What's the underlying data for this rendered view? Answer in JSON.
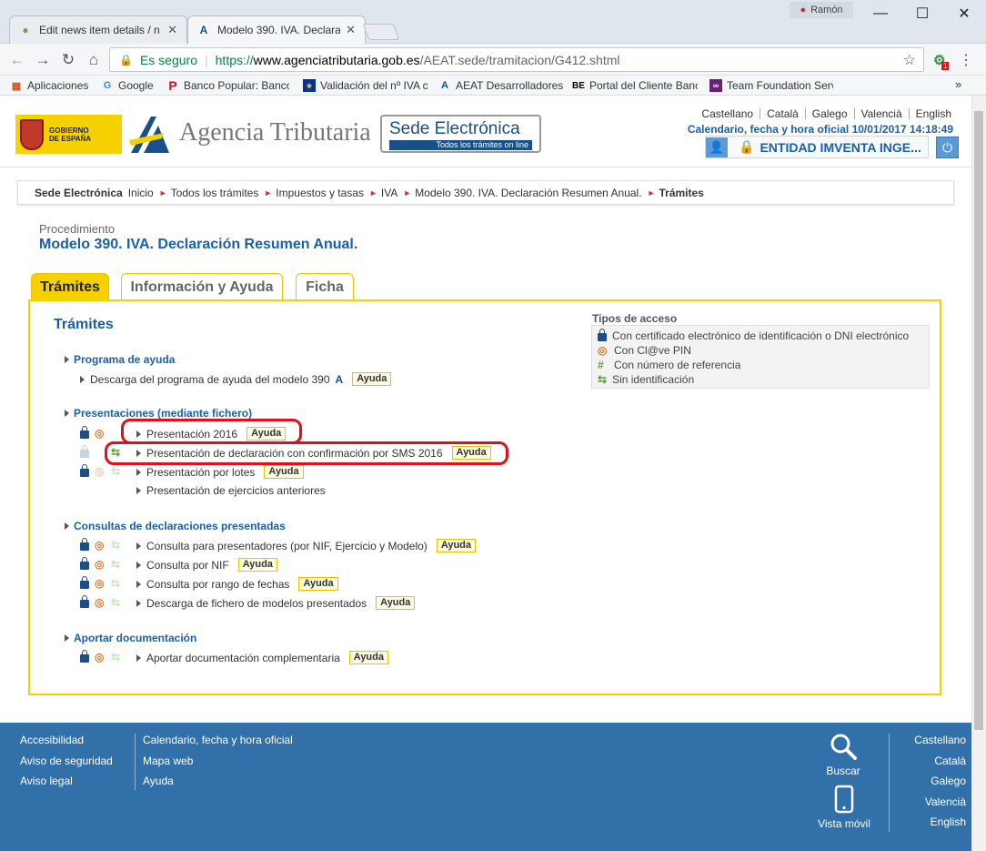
{
  "browser": {
    "user": "Ramón",
    "tabs": [
      {
        "title": "Edit news item details / n",
        "active": false
      },
      {
        "title": "Modelo 390. IVA. Declara",
        "active": true
      }
    ],
    "omnibox": {
      "secure_label": "Es seguro",
      "url_scheme": "https://",
      "url_host": "www.agenciatributaria.gob.es",
      "url_path": "/AEAT.sede/tramitacion/G412.shtml"
    },
    "extension_badge": "1",
    "bookmarks": [
      {
        "label": "Aplicaciones",
        "icon": "apps-grid-icon"
      },
      {
        "label": "Google",
        "icon": "google-icon"
      },
      {
        "label": "Banco Popular: Banco",
        "icon": "banco-popular-icon"
      },
      {
        "label": "Validación del nº IVA c",
        "icon": "eu-flag-icon"
      },
      {
        "label": "AEAT Desarrolladores",
        "icon": "aeat-icon"
      },
      {
        "label": "Portal del Cliente Banc",
        "icon": "be-icon"
      },
      {
        "label": "Team Foundation Serv",
        "icon": "visual-studio-icon"
      }
    ],
    "more_bookmarks": "»"
  },
  "header": {
    "gobierno_line1": "GOBIERNO",
    "gobierno_line2": "DE ESPAÑA",
    "agency": "Agencia Tributaria",
    "sede_title": "Sede Electrónica",
    "sede_sub": "Todos los trámites on line",
    "languages": [
      "Castellano",
      "Català",
      "Galego",
      "Valencià",
      "English"
    ],
    "calendar": "Calendario, fecha y hora oficial 10/01/2017 14:18:49",
    "entity": "ENTIDAD IMVENTA INGE..."
  },
  "breadcrumb": {
    "root": "Sede Electrónica",
    "items": [
      "Inicio",
      "Todos los trámites",
      "Impuestos y tasas",
      "IVA",
      "Modelo 390. IVA. Declaración Resumen Anual."
    ],
    "current": "Trámites"
  },
  "procedure": {
    "label": "Procedimiento",
    "title": "Modelo 390. IVA. Declaración Resumen Anual."
  },
  "tabs": [
    {
      "label": "Trámites",
      "active": true
    },
    {
      "label": "Información y Ayuda",
      "active": false
    },
    {
      "label": "Ficha",
      "active": false
    }
  ],
  "panel": {
    "heading": "Trámites",
    "help_label": "Ayuda",
    "access_types": {
      "title": "Tipos de acceso",
      "items": [
        {
          "label": "Con certificado electrónico de identificación o DNI electrónico",
          "icon": "lock-icon"
        },
        {
          "label": "Con Cl@ve PIN",
          "icon": "clave-icon"
        },
        {
          "label": "Con número de referencia",
          "icon": "hash-icon"
        },
        {
          "label": "Sin identificación",
          "icon": "arrows-icon"
        }
      ]
    },
    "sections": [
      {
        "title": "Programa de ayuda",
        "items": [
          {
            "label": "Descarga del programa de ayuda del modelo 390",
            "help": true
          }
        ]
      },
      {
        "title": "Presentaciones (mediante fichero)",
        "items": [
          {
            "label": "Presentación 2016",
            "help": true
          },
          {
            "label": "Presentación de declaración con confirmación por SMS 2016",
            "help": true
          },
          {
            "label": "Presentación por lotes",
            "help": true
          },
          {
            "label": "Presentación de ejercicios anteriores",
            "help": false
          }
        ]
      },
      {
        "title": "Consultas de declaraciones presentadas",
        "items": [
          {
            "label": "Consulta para presentadores (por NIF, Ejercicio y Modelo)",
            "help": true
          },
          {
            "label": "Consulta por NIF",
            "help": true
          },
          {
            "label": "Consulta por rango de fechas",
            "help": true
          },
          {
            "label": "Descarga de fichero de modelos presentados",
            "help": true
          }
        ]
      },
      {
        "title": "Aportar documentación",
        "items": [
          {
            "label": "Aportar documentación complementaria",
            "help": true
          }
        ]
      }
    ]
  },
  "footer": {
    "col1": [
      "Accesibilidad",
      "Aviso de seguridad",
      "Aviso legal"
    ],
    "col2": [
      "Calendario, fecha y hora oficial",
      "Mapa web",
      "Ayuda"
    ],
    "search_label": "Buscar",
    "mobile_label": "Vista móvil",
    "languages": [
      "Castellano",
      "Català",
      "Galego",
      "Valencià",
      "English"
    ]
  },
  "colors": {
    "brand_blue": "#1a5fa8",
    "tab_yellow": "#f6d100",
    "footer_blue": "#3170a9",
    "highlight_red": "#e0101a"
  }
}
